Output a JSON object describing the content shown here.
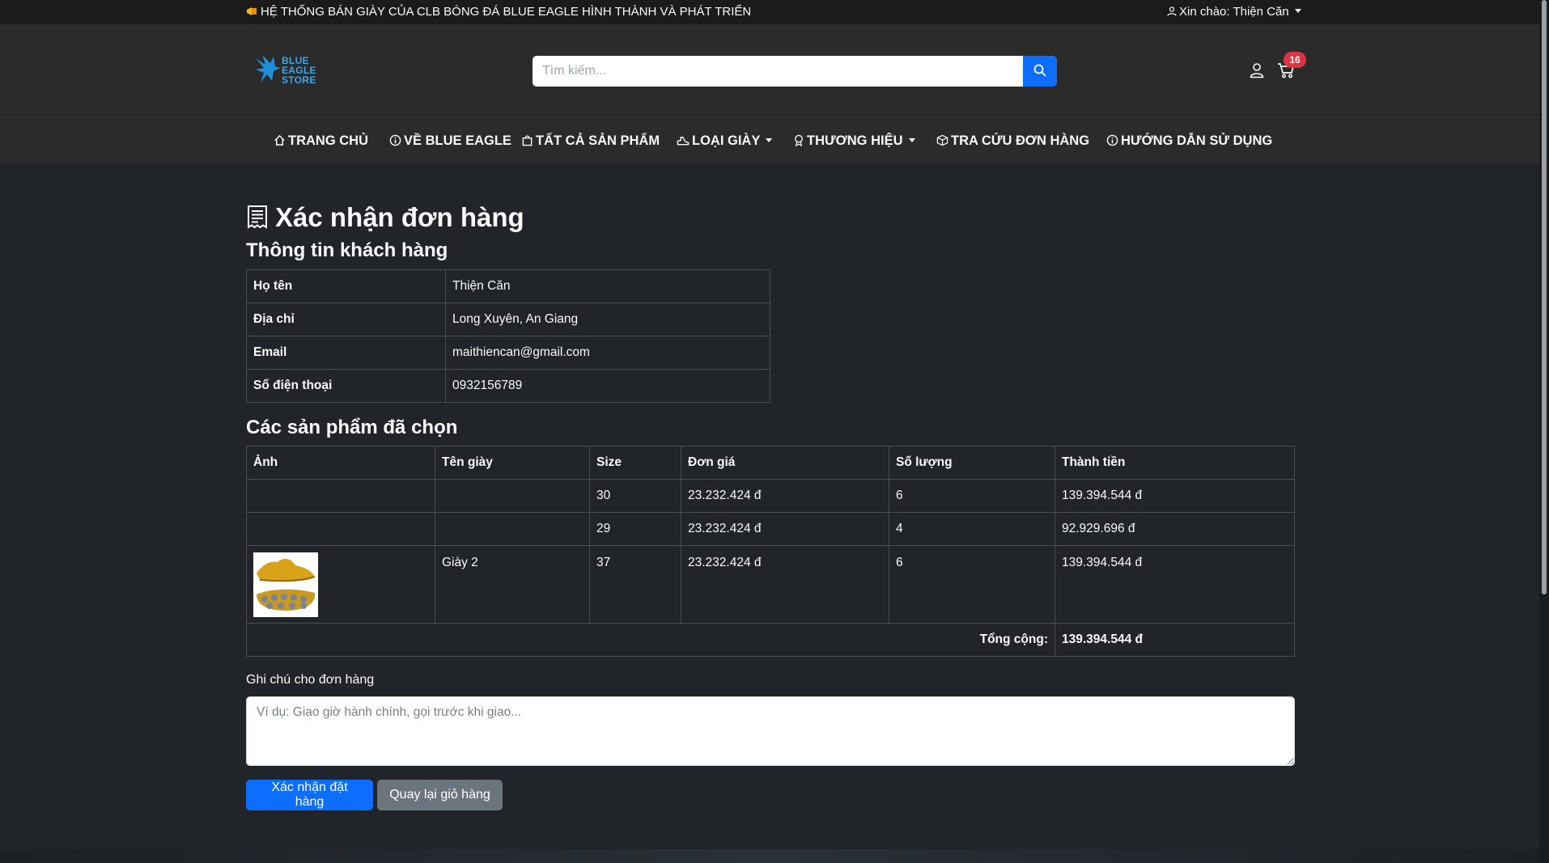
{
  "topbar": {
    "announcement": "HỆ THỐNG BÁN GIÀY CỦA CLB BÓNG ĐÁ BLUE EAGLE HÌNH THÀNH VÀ PHÁT TRIỂN",
    "greeting": "Xin chào: Thiện Căn"
  },
  "header": {
    "logo_lines": [
      "BLUE",
      "EAGLE",
      "STORE"
    ],
    "search_placeholder": "Tìm kiếm...",
    "cart_count": "16"
  },
  "nav": {
    "items": [
      {
        "label": "TRANG CHỦ",
        "icon": "house-icon"
      },
      {
        "label": "VỀ BLUE EAGLE",
        "icon": "info-circle-icon"
      },
      {
        "label": "TẤT CẢ SẢN PHẨM",
        "icon": "bag-icon"
      },
      {
        "label": "LOẠI GIÀY",
        "icon": "shoe-icon",
        "dropdown": true
      },
      {
        "label": "THƯƠNG HIỆU",
        "icon": "award-icon",
        "dropdown": true
      },
      {
        "label": "TRA CỨU ĐƠN HÀNG",
        "icon": "box-icon"
      },
      {
        "label": "HƯỚNG DẪN SỬ DỤNG",
        "icon": "info-circle-icon"
      }
    ]
  },
  "page": {
    "title": "Xác nhận đơn hàng",
    "customer_section": "Thông tin khách hàng",
    "products_section": "Các sản phẩm đã chọn"
  },
  "customer": [
    {
      "key": "Họ tên",
      "value": "Thiện Căn"
    },
    {
      "key": "Địa chỉ",
      "value": "Long Xuyên, An Giang"
    },
    {
      "key": "Email",
      "value": "maithiencan@gmail.com"
    },
    {
      "key": "Số điện thoại",
      "value": "0932156789"
    }
  ],
  "products": {
    "headers": [
      "Ảnh",
      "Tên giày",
      "Size",
      "Đơn giá",
      "Số lượng",
      "Thành tiền"
    ],
    "rows": [
      {
        "image": false,
        "name": "",
        "size": "30",
        "price": "23.232.424 đ",
        "qty": "6",
        "total": "139.394.544 đ"
      },
      {
        "image": false,
        "name": "",
        "size": "29",
        "price": "23.232.424 đ",
        "qty": "4",
        "total": "92.929.696 đ"
      },
      {
        "image": true,
        "name": "Giày 2",
        "size": "37",
        "price": "23.232.424 đ",
        "qty": "6",
        "total": "139.394.544 đ"
      }
    ],
    "total_label": "Tổng cộng:",
    "total_value": "139.394.544 đ"
  },
  "note": {
    "label": "Ghi chú cho đơn hàng",
    "placeholder": "Ví dụ: Giao giờ hành chính, gọi trước khi giao..."
  },
  "actions": {
    "confirm": "Xác nhận đặt hàng",
    "back": "Quay lại giỏ hàng"
  },
  "colors": {
    "background": "#212529",
    "header": "#2b2b2b",
    "primary": "#0d6efd",
    "secondary": "#6c757d",
    "badge": "#dc3545",
    "logo": "#3aa6e8"
  }
}
